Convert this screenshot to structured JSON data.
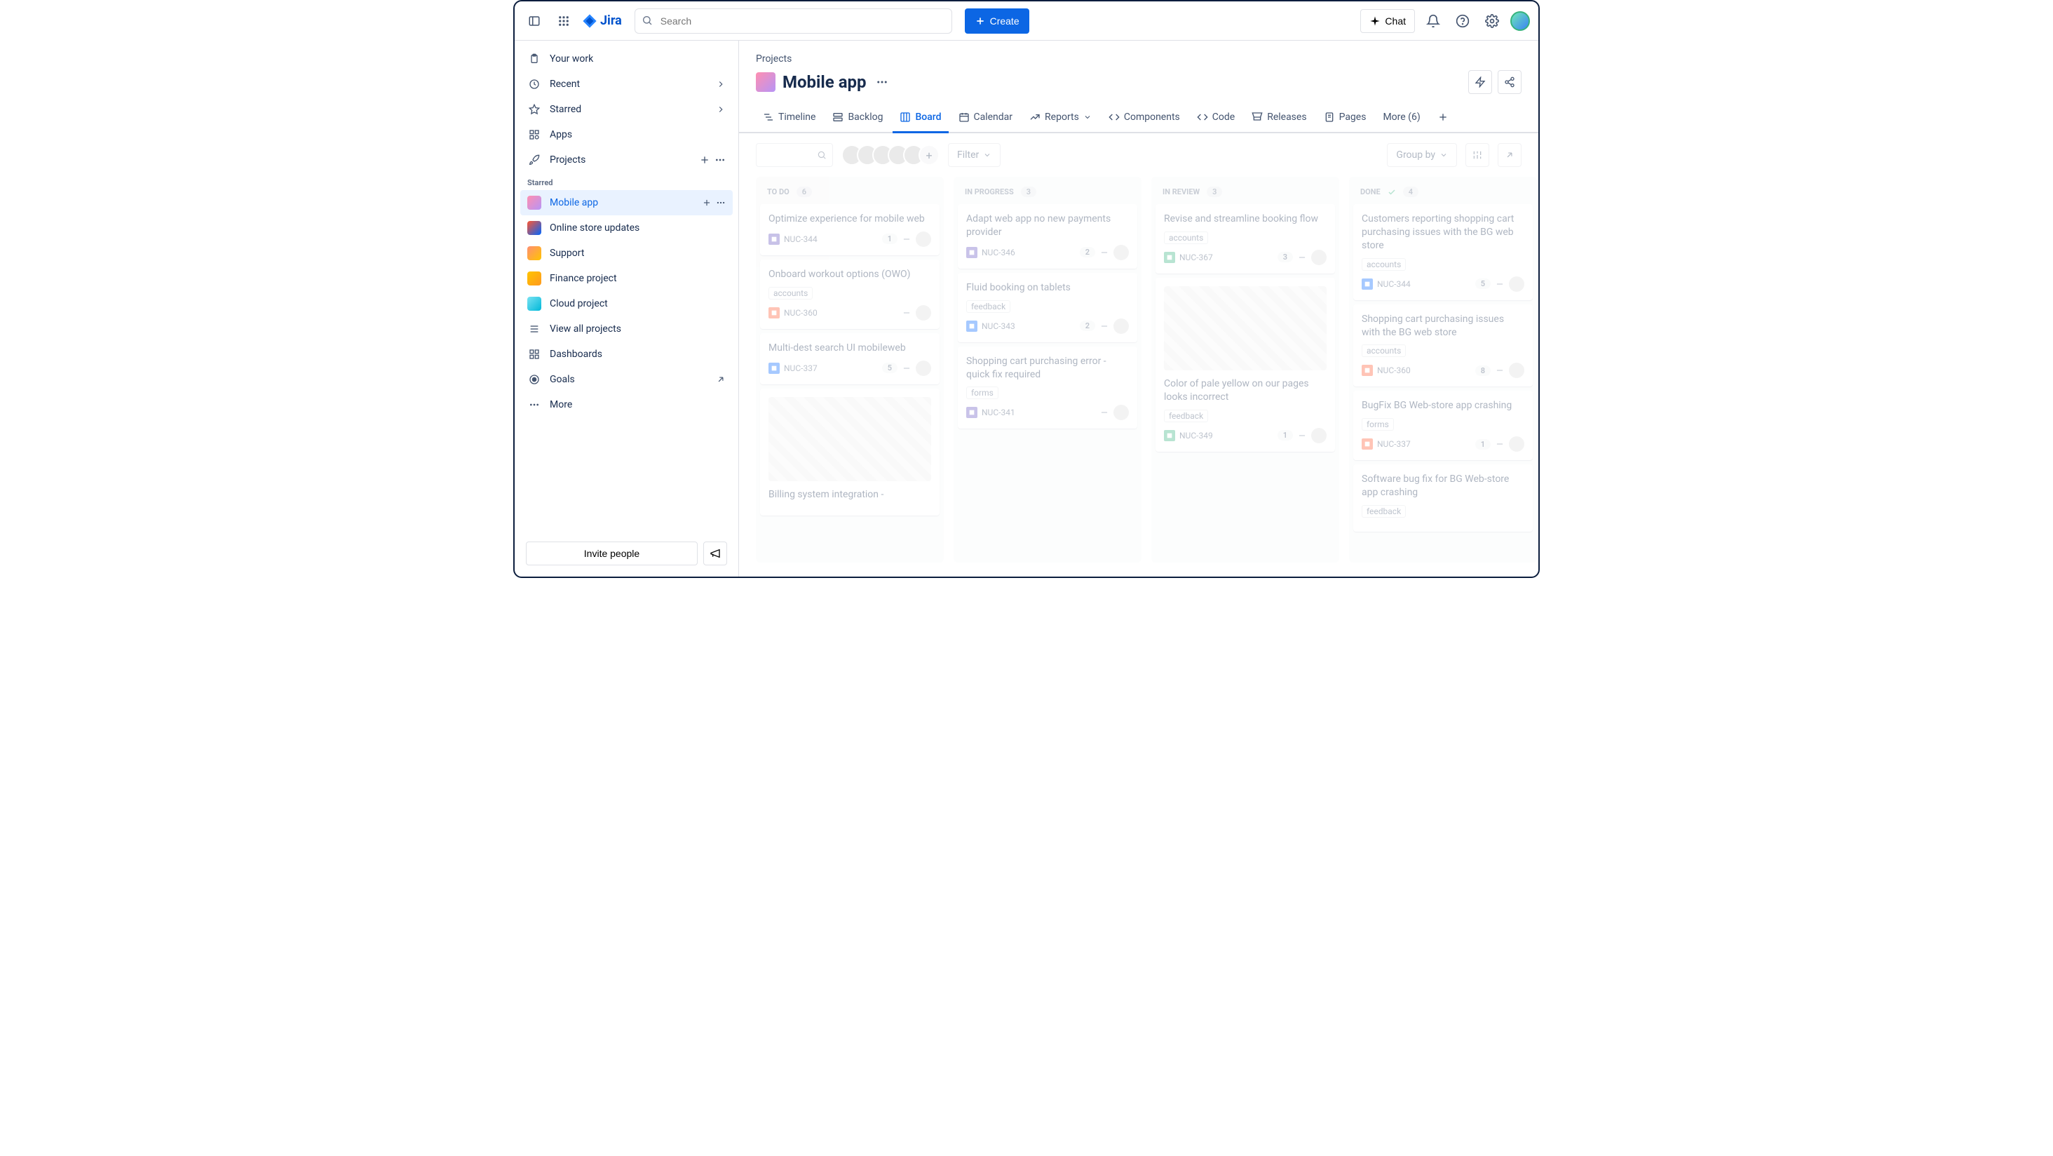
{
  "header": {
    "logo": "Jira",
    "search_placeholder": "Search",
    "create": "Create",
    "chat": "Chat"
  },
  "sidebar": {
    "nav": [
      {
        "label": "Your work",
        "icon": "clipboard"
      },
      {
        "label": "Recent",
        "icon": "clock",
        "chev": true
      },
      {
        "label": "Starred",
        "icon": "star",
        "chev": true
      },
      {
        "label": "Apps",
        "icon": "grid"
      },
      {
        "label": "Projects",
        "icon": "rocket",
        "add": true,
        "more": true
      }
    ],
    "starred_label": "Starred",
    "projects": [
      {
        "label": "Mobile app",
        "active": true,
        "color": "linear-gradient(135deg,#FF8FB1,#B794F6)",
        "add": true,
        "more": true
      },
      {
        "label": "Online store updates",
        "color": "linear-gradient(135deg,#FF5630,#0065FF)"
      },
      {
        "label": "Support",
        "color": "linear-gradient(135deg,#FF8F73,#FFC400)"
      },
      {
        "label": "Finance project",
        "color": "linear-gradient(135deg,#FFC400,#FF991F)"
      },
      {
        "label": "Cloud project",
        "color": "linear-gradient(135deg,#79E2F2,#00B8D9)"
      }
    ],
    "view_all": "View all projects",
    "dashboards": "Dashboards",
    "goals": "Goals",
    "more": "More",
    "invite": "Invite people"
  },
  "main": {
    "breadcrumb": "Projects",
    "title": "Mobile app",
    "tabs": [
      {
        "label": "Timeline",
        "icon": "timeline"
      },
      {
        "label": "Backlog",
        "icon": "backlog"
      },
      {
        "label": "Board",
        "icon": "board",
        "active": true
      },
      {
        "label": "Calendar",
        "icon": "calendar"
      },
      {
        "label": "Reports",
        "icon": "reports",
        "chev": true
      },
      {
        "label": "Components",
        "icon": "components"
      },
      {
        "label": "Code",
        "icon": "code"
      },
      {
        "label": "Releases",
        "icon": "releases"
      },
      {
        "label": "Pages",
        "icon": "pages"
      }
    ],
    "more_tab": "More (6)",
    "filter": "Filter",
    "groupby": "Group by"
  },
  "board": {
    "columns": [
      {
        "name": "TO DO",
        "count": "6",
        "cards": [
          {
            "title": "Optimize experience for mobile web",
            "key": "NUC-344",
            "type": "epic",
            "num": "1",
            "prio": "="
          },
          {
            "title": "Onboard workout options (OWO)",
            "tag": "accounts",
            "key": "NUC-360",
            "type": "bug",
            "prio": "^"
          },
          {
            "title": "Multi-dest search UI mobileweb",
            "key": "NUC-337",
            "type": "task",
            "num": "5",
            "prio": "vv"
          },
          {
            "img": true,
            "title": "Billing system integration -",
            "key": ""
          }
        ]
      },
      {
        "name": "IN PROGRESS",
        "count": "3",
        "cards": [
          {
            "title": "Adapt web app no new payments provider",
            "key": "NUC-346",
            "type": "epic",
            "num": "2",
            "prio": "^^"
          },
          {
            "title": "Fluid booking on tablets",
            "tag": "feedback",
            "key": "NUC-343",
            "type": "task",
            "num": "2",
            "prio": "child"
          },
          {
            "title": "Shopping cart purchasing error - quick fix required",
            "tag": "forms",
            "key": "NUC-341",
            "type": "epic",
            "prio": "="
          }
        ]
      },
      {
        "name": "IN REVIEW",
        "count": "3",
        "cards": [
          {
            "title": "Revise and streamline booking flow",
            "tag": "accounts",
            "key": "NUC-367",
            "type": "story",
            "num": "3",
            "prio": "branch"
          },
          {
            "img": true,
            "title": "Color of pale yellow on our pages looks incorrect",
            "tag": "feedback",
            "key": "NUC-349",
            "type": "story",
            "num": "1",
            "prio": "branch"
          }
        ]
      },
      {
        "name": "DONE",
        "count": "4",
        "check": true,
        "cards": [
          {
            "title": "Customers reporting shopping cart purchasing issues with the BG web store",
            "tag": "accounts",
            "key": "NUC-344",
            "type": "task",
            "num": "5",
            "prio": "branch"
          },
          {
            "title": "Shopping cart purchasing issues with the BG web store",
            "tag": "accounts",
            "key": "NUC-360",
            "type": "bug",
            "num": "8",
            "prio": "branch"
          },
          {
            "title": "BugFix BG Web-store app crashing",
            "tag": "forms",
            "key": "NUC-337",
            "type": "bug",
            "num": "1",
            "prio": "branch"
          },
          {
            "title": "Software bug fix for BG Web-store app crashing",
            "tag": "feedback",
            "key": ""
          }
        ]
      }
    ]
  }
}
